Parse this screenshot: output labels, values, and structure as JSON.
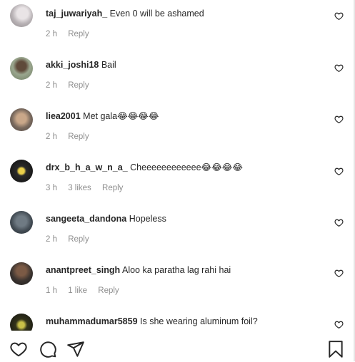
{
  "comments": [
    {
      "username": "taj_juwariyah_",
      "text": "Even 0 will be ashamed",
      "time": "2 h",
      "likes": "",
      "reply": "Reply"
    },
    {
      "username": "akki_joshi18",
      "text": "Bail",
      "time": "2 h",
      "likes": "",
      "reply": "Reply"
    },
    {
      "username": "liea2001",
      "text": "Met gala😂😂😂😂",
      "time": "2 h",
      "likes": "",
      "reply": "Reply"
    },
    {
      "username": "drx_b_h_a_w_n_a_",
      "text": "Cheeeeeeeeeeee😂😂😂😂",
      "time": "3 h",
      "likes": "3 likes",
      "reply": "Reply"
    },
    {
      "username": "sangeeta_dandona",
      "text": "Hopeless",
      "time": "2 h",
      "likes": "",
      "reply": "Reply"
    },
    {
      "username": "anantpreet_singh",
      "text": "Aloo ka paratha lag rahi hai",
      "time": "1 h",
      "likes": "1 like",
      "reply": "Reply"
    },
    {
      "username": "muhammadumar5859",
      "text": "Is she wearing aluminum foil?",
      "time": "",
      "likes": "",
      "reply": ""
    }
  ],
  "actions": {
    "like_icon": "heart-outline",
    "comment_icon": "speech-bubble",
    "share_icon": "paper-plane",
    "save_icon": "bookmark"
  }
}
